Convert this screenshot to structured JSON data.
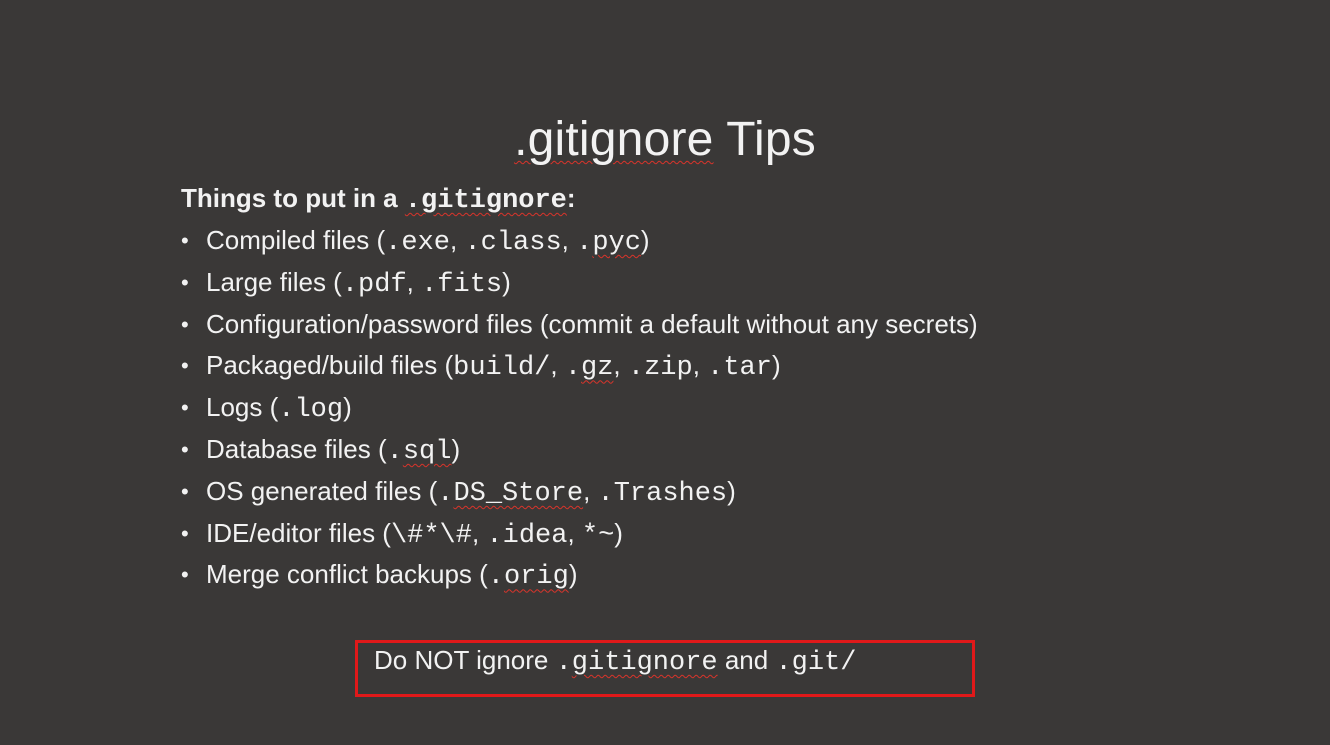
{
  "slide": {
    "title_code": ".gitignore",
    "title_rest": " Tips"
  },
  "heading": {
    "text": "Things to put in a ",
    "code": ".gitignore",
    "suffix": ":"
  },
  "bullets": [
    {
      "parts": [
        {
          "t": "Compiled files ("
        },
        {
          "c": ".exe"
        },
        {
          "t": ", "
        },
        {
          "c": ".class"
        },
        {
          "t": ", "
        },
        {
          "c": ".",
          "s": false
        },
        {
          "c": "pyc",
          "s": true
        },
        {
          "t": ")"
        }
      ]
    },
    {
      "parts": [
        {
          "t": "Large files ("
        },
        {
          "c": ".pdf"
        },
        {
          "t": ", "
        },
        {
          "c": ".fits"
        },
        {
          "t": ")"
        }
      ]
    },
    {
      "parts": [
        {
          "t": "Configuration/password files (commit a default without any secrets)"
        }
      ]
    },
    {
      "parts": [
        {
          "t": "Packaged/build files ("
        },
        {
          "c": "build/"
        },
        {
          "t": ", "
        },
        {
          "c": "."
        },
        {
          "c": "gz",
          "s": true
        },
        {
          "t": ", "
        },
        {
          "c": ".zip"
        },
        {
          "t": ", "
        },
        {
          "c": ".tar"
        },
        {
          "t": ")"
        }
      ]
    },
    {
      "parts": [
        {
          "t": "Logs ("
        },
        {
          "c": ".log"
        },
        {
          "t": ")"
        }
      ]
    },
    {
      "parts": [
        {
          "t": "Database files ("
        },
        {
          "c": "."
        },
        {
          "c": "sql",
          "s": true
        },
        {
          "t": ")"
        }
      ]
    },
    {
      "parts": [
        {
          "t": "OS generated files ("
        },
        {
          "c": "."
        },
        {
          "c": "DS_Store",
          "s": true
        },
        {
          "t": ", "
        },
        {
          "c": ".Trashes"
        },
        {
          "t": ")"
        }
      ]
    },
    {
      "parts": [
        {
          "t": "IDE/editor files ("
        },
        {
          "c": "\\#*\\#"
        },
        {
          "t": ", "
        },
        {
          "c": ".idea"
        },
        {
          "t": ", "
        },
        {
          "c": "*~"
        },
        {
          "t": ")"
        }
      ]
    },
    {
      "parts": [
        {
          "t": "Merge conflict backups ("
        },
        {
          "c": "."
        },
        {
          "c": "orig",
          "s": true
        },
        {
          "t": ")"
        }
      ]
    }
  ],
  "bullet_glyph": "•",
  "callout": {
    "prefix": "Do NOT ignore ",
    "code1_dot": ".",
    "code1_word": "gitignore",
    "middle": " and ",
    "code2": ".git/"
  },
  "colors": {
    "background": "#3a3837",
    "text": "#f2f2f2",
    "callout_border": "#e0191a",
    "spellcheck_squiggle": "#d9342b"
  }
}
